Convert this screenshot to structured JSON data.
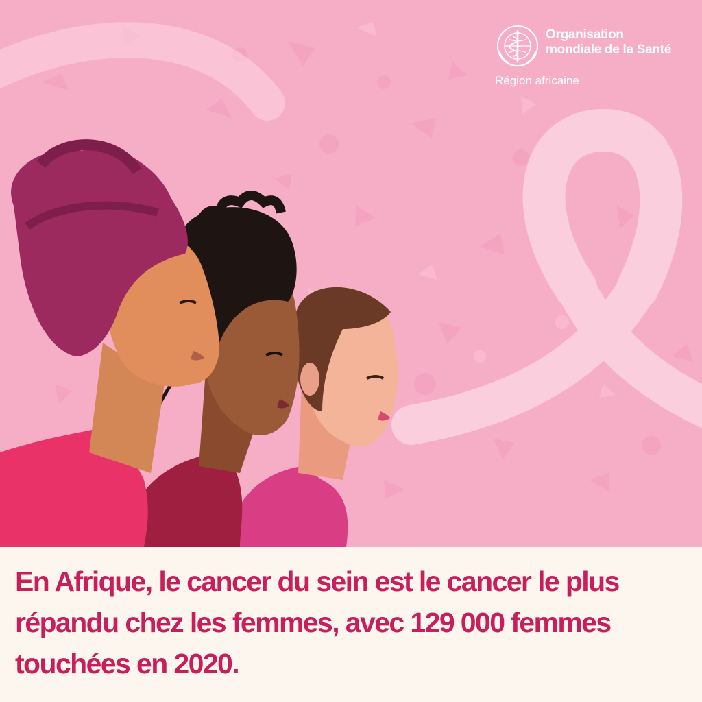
{
  "organization": {
    "name_line1": "Organisation",
    "name_line2": "mondiale de la Santé",
    "region": "Région africaine",
    "emblem_icon": "who-emblem-icon"
  },
  "illustration": {
    "icons": [
      "pink-ribbon-icon",
      "women-profiles-illustration"
    ],
    "colors": {
      "background": "#f6aec7",
      "ribbon": "#fbd0de",
      "headwrap": "#9c2a5e",
      "top_left": "#e83268",
      "top_middle": "#9e1f3f",
      "top_right": "#d93e84"
    }
  },
  "caption": {
    "text": "En Afrique, le cancer du sein est le cancer le plus répandu chez les femmes, avec 129 000 femmes touchées en 2020.",
    "color": "#c81e5b"
  }
}
